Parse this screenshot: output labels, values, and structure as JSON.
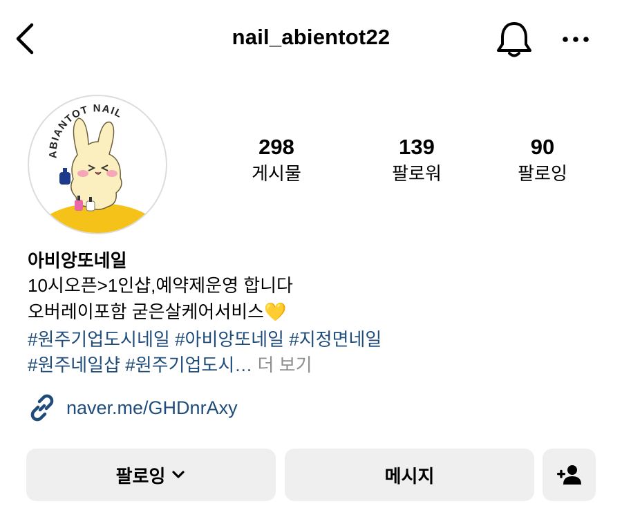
{
  "header": {
    "username": "nail_abientot22",
    "back_icon": "chevron-left-icon",
    "bell_icon": "bell-icon",
    "more_icon": "more-horizontal-icon"
  },
  "avatar": {
    "logo_text": "ABIANTOT NAIL"
  },
  "stats": [
    {
      "value": "298",
      "label": "게시물"
    },
    {
      "value": "139",
      "label": "팔로워"
    },
    {
      "value": "90",
      "label": "팔로잉"
    }
  ],
  "bio": {
    "name": "아비앙또네일",
    "line1": "10시오픈>1인샵,예약제운영 합니다",
    "line2": "오버레이포함 굳은살케어서비스",
    "line2_emoji": "💛",
    "hashtags_line1": [
      "#원주기업도시네일",
      "#아비앙또네일",
      "#지정면네일"
    ],
    "hashtags_line2": [
      "#원주네일샵",
      "#원주기업도시…"
    ],
    "more_label": "더 보기"
  },
  "link": {
    "text": "naver.me/GHDnrAxy",
    "icon": "link-icon"
  },
  "buttons": {
    "following_label": "팔로잉",
    "message_label": "메시지",
    "add_user_icon": "add-person-icon"
  },
  "colors": {
    "hashtag": "#1f4c7a",
    "muted": "#8e8e8e",
    "button_bg": "#efefef"
  }
}
